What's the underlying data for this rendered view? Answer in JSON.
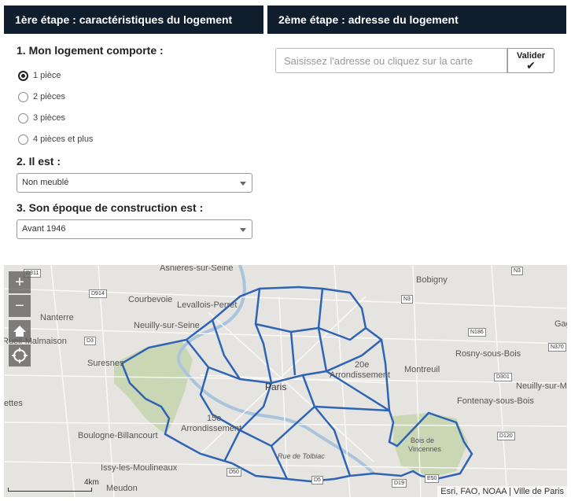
{
  "step1": {
    "header": "1ère étape : caractéristiques du logement",
    "q1": {
      "title": "1. Mon logement comporte :",
      "options": [
        "1 pièce",
        "2 pièces",
        "3 pièces",
        "4 pièces et plus"
      ],
      "selected_index": 0
    },
    "q2": {
      "title": "2. Il est :",
      "value": "Non meublé"
    },
    "q3": {
      "title": "3. Son époque de construction est :",
      "value": "Avant 1946"
    }
  },
  "step2": {
    "header": "2ème étape : adresse du logement",
    "placeholder": "Saisissez l'adresse ou cliquez sur la carte",
    "validate_label": "Valider",
    "validate_icon": "checkmark-icon"
  },
  "map": {
    "zoom_in": "+",
    "zoom_out": "−",
    "labels": {
      "asnieres": "Asnières-sur-Seine",
      "bobigny": "Bobigny",
      "courbevoie": "Courbevoie",
      "levallois": "Levallois-Perret",
      "nanterre": "Nanterre",
      "neuilly_seine": "Neuilly-sur-Seine",
      "rueil": "Rueil-Malmaison",
      "suresnes": "Suresnes",
      "rosny": "Rosny-sous-Bois",
      "arr20": "20e",
      "arr20b": "Arrondissement",
      "montreuil": "Montreuil",
      "neuilly_marne": "Neuilly-sur-Marne",
      "paris": "Paris",
      "ettes": "ettes",
      "fontenay": "Fontenay-sous-Bois",
      "arr15": "15e",
      "arr15b": "Arrondissement",
      "boulogne": "Boulogne-Billancourt",
      "bois": "Bois de",
      "bois2": "Vincennes",
      "tolbiac": "Rue de Tolbiac",
      "issy": "Issy-les-Moulineaux",
      "meudon": "Meudon",
      "gag": "Gag"
    },
    "roads": {
      "d311": "D311",
      "d914": "D914",
      "n3": "N3",
      "n3b": "N3",
      "d3": "D3",
      "n186": "N186",
      "n370": "N370",
      "d301": "D301",
      "d120": "D120",
      "d50": "D50",
      "d19": "D19",
      "e50": "E50",
      "d5": "D5"
    },
    "scale": "4km",
    "attribution": "Esri, FAO, NOAA | Ville de Paris",
    "colors": {
      "boundary": "#2f64b4",
      "park": "#c9d7b5"
    }
  }
}
